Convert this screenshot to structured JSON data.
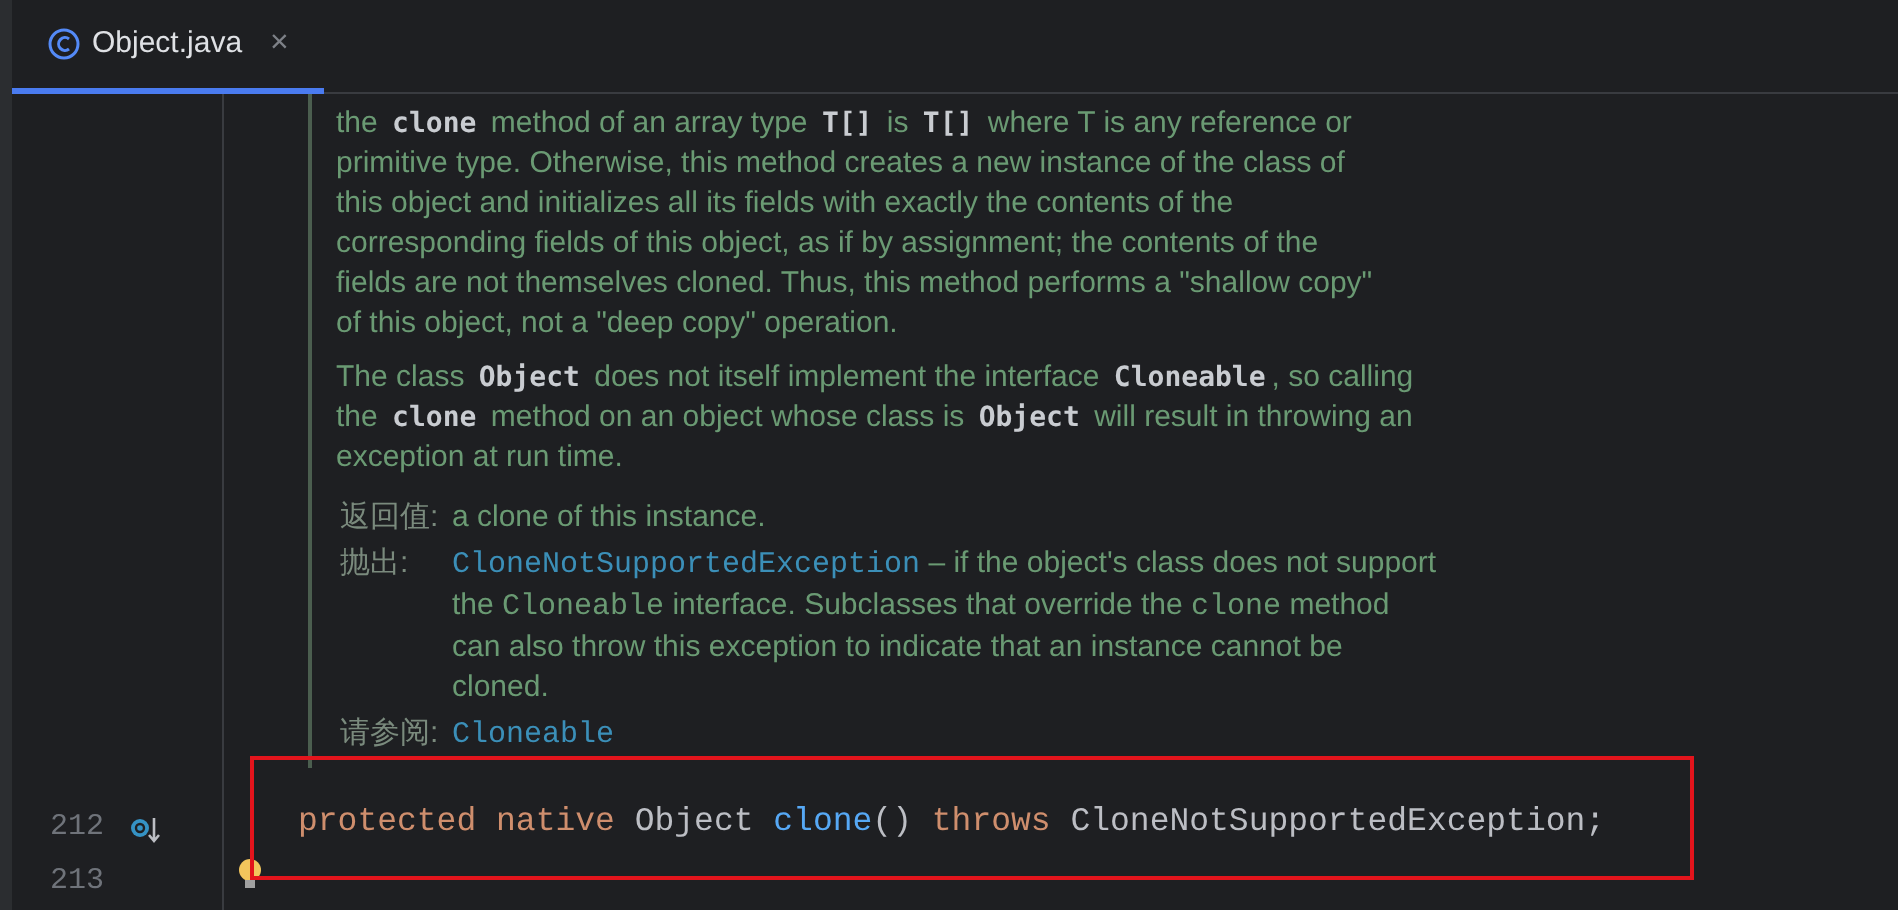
{
  "tabs": [
    {
      "label": "Object.java",
      "selected": true,
      "close": "×"
    }
  ],
  "doc": {
    "paragraphs": [
      [
        [
          {
            "kind": "text",
            "t": "the "
          },
          {
            "kind": "code",
            "t": "clone"
          },
          {
            "kind": "text",
            "t": " method of an array type "
          },
          {
            "kind": "code",
            "t": "T[]"
          },
          {
            "kind": "text",
            "t": " is "
          },
          {
            "kind": "code",
            "t": "T[]"
          },
          {
            "kind": "text",
            "t": " where T is any reference or"
          }
        ],
        [
          {
            "kind": "text",
            "t": "primitive type. Otherwise, this method creates a new instance of the class of"
          }
        ],
        [
          {
            "kind": "text",
            "t": "this object and initializes all its fields with exactly the contents of the"
          }
        ],
        [
          {
            "kind": "text",
            "t": "corresponding fields of this object, as if by assignment; the contents of the"
          }
        ],
        [
          {
            "kind": "text",
            "t": "fields are not themselves cloned. Thus, this method performs a \"shallow copy\""
          }
        ],
        [
          {
            "kind": "text",
            "t": "of this object, not a \"deep copy\" operation."
          }
        ]
      ],
      [
        [
          {
            "kind": "text",
            "t": "The class "
          },
          {
            "kind": "code",
            "t": "Object"
          },
          {
            "kind": "text",
            "t": " does not itself implement the interface "
          },
          {
            "kind": "code",
            "t": "Cloneable"
          },
          {
            "kind": "text",
            "t": ", so calling"
          }
        ],
        [
          {
            "kind": "text",
            "t": "the "
          },
          {
            "kind": "code",
            "t": "clone"
          },
          {
            "kind": "text",
            "t": " method on an object whose class is "
          },
          {
            "kind": "code",
            "t": "Object"
          },
          {
            "kind": "text",
            "t": " will result in throwing an"
          }
        ],
        [
          {
            "kind": "text",
            "t": "exception at run time."
          }
        ]
      ]
    ],
    "tags": [
      {
        "label": "返回值:",
        "lines": [
          [
            {
              "kind": "text",
              "t": "a clone of this instance."
            }
          ]
        ]
      },
      {
        "label": "抛出:",
        "lines": [
          [
            {
              "kind": "link",
              "t": "CloneNotSupportedException"
            },
            {
              "kind": "text",
              "t": " – if the object's class does not support"
            }
          ],
          [
            {
              "kind": "text",
              "t": "the "
            },
            {
              "kind": "mono",
              "t": "Cloneable"
            },
            {
              "kind": "text",
              "t": " interface. Subclasses that override the "
            },
            {
              "kind": "mono",
              "t": "clone"
            },
            {
              "kind": "text",
              "t": " method"
            }
          ],
          [
            {
              "kind": "text",
              "t": "can also throw this exception to indicate that an instance cannot be"
            }
          ],
          [
            {
              "kind": "text",
              "t": "cloned."
            }
          ]
        ]
      },
      {
        "label": "请参阅:",
        "lines": [
          [
            {
              "kind": "link",
              "t": "Cloneable"
            }
          ]
        ]
      }
    ]
  },
  "code_lines": [
    {
      "number": "212",
      "gutter_icon": true,
      "tokens": [
        {
          "kind": "keyword",
          "t": "protected"
        },
        {
          "kind": "keyword",
          "t": " native"
        },
        {
          "kind": "plain",
          "t": " Object "
        },
        {
          "kind": "method",
          "t": "clone"
        },
        {
          "kind": "plain",
          "t": "() "
        },
        {
          "kind": "keyword",
          "t": "throws"
        },
        {
          "kind": "plain",
          "t": " CloneNotSupportedException;"
        }
      ]
    },
    {
      "number": "213",
      "bulb": true
    }
  ]
}
